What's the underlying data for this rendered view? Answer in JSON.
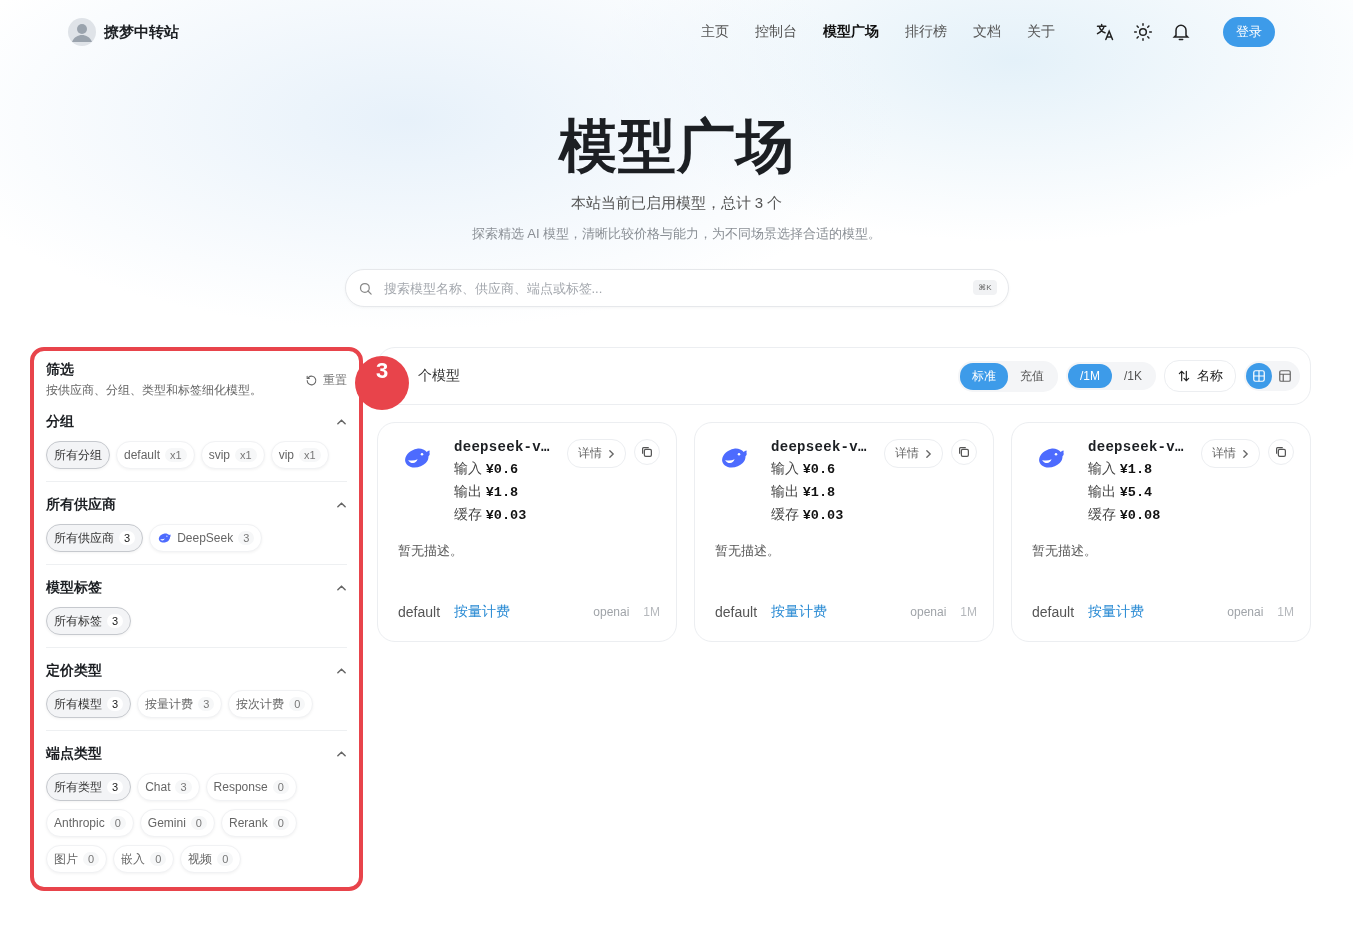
{
  "site": {
    "name": "撩梦中转站"
  },
  "nav": [
    {
      "label": "主页",
      "selected": false
    },
    {
      "label": "控制台",
      "selected": false
    },
    {
      "label": "模型广场",
      "selected": true
    },
    {
      "label": "排行榜",
      "selected": false
    },
    {
      "label": "文档",
      "selected": false
    },
    {
      "label": "关于",
      "selected": false
    }
  ],
  "login": "登录",
  "hero": {
    "title": "模型广场",
    "subtitle": "本站当前已启用模型，总计 3 个",
    "description": "探索精选 AI 模型，清晰比较价格与能力，为不同场景选择合适的模型。"
  },
  "search": {
    "placeholder": "搜索模型名称、供应商、端点或标签...",
    "shortcut": "⌘K"
  },
  "filters": {
    "title": "筛选",
    "description": "按供应商、分组、类型和标签细化模型。",
    "reset": "重置",
    "sections": [
      {
        "title": "分组",
        "expanded": true,
        "chips": [
          {
            "kind": "plain",
            "label": "所有分组",
            "selected": true
          },
          {
            "kind": "plain",
            "label": "default",
            "count": "x1",
            "selected": false
          },
          {
            "kind": "plain",
            "label": "svip",
            "count": "x1",
            "selected": false
          },
          {
            "kind": "plain",
            "label": "vip",
            "count": "x1",
            "selected": false
          }
        ]
      },
      {
        "title": "所有供应商",
        "expanded": true,
        "chips": [
          {
            "kind": "plain",
            "label": "所有供应商",
            "count": "3",
            "selected": true
          },
          {
            "kind": "brand",
            "label": "DeepSeek",
            "count": "3",
            "selected": false
          }
        ]
      },
      {
        "title": "模型标签",
        "expanded": true,
        "chips": [
          {
            "kind": "plain",
            "label": "所有标签",
            "count": "3",
            "selected": true
          }
        ]
      },
      {
        "title": "定价类型",
        "expanded": true,
        "chips": [
          {
            "kind": "plain",
            "label": "所有模型",
            "count": "3",
            "selected": true
          },
          {
            "kind": "plain",
            "label": "按量计费",
            "count": "3",
            "selected": false
          },
          {
            "kind": "plain",
            "label": "按次计费",
            "count": "0",
            "selected": false
          }
        ]
      },
      {
        "title": "端点类型",
        "expanded": true,
        "chips": [
          {
            "kind": "plain",
            "label": "所有类型",
            "count": "3",
            "selected": true
          },
          {
            "kind": "plain",
            "label": "Chat",
            "count": "3",
            "selected": false
          },
          {
            "kind": "plain",
            "label": "Response",
            "count": "0",
            "selected": false
          },
          {
            "kind": "plain",
            "label": "Anthropic",
            "count": "0",
            "selected": false
          },
          {
            "kind": "plain",
            "label": "Gemini",
            "count": "0",
            "selected": false
          },
          {
            "kind": "plain",
            "label": "Rerank",
            "count": "0",
            "selected": false
          },
          {
            "kind": "plain",
            "label": "图片",
            "count": "0",
            "selected": false
          },
          {
            "kind": "plain",
            "label": "嵌入",
            "count": "0",
            "selected": false
          },
          {
            "kind": "plain",
            "label": "视频",
            "count": "0",
            "selected": false
          }
        ]
      }
    ]
  },
  "annotation": {
    "label": "3"
  },
  "toolbar": {
    "count_label": "个模型",
    "price_modes": [
      {
        "label": "标准",
        "selected": true
      },
      {
        "label": "充值",
        "selected": false
      }
    ],
    "units": [
      {
        "label": "/1M",
        "selected": true
      },
      {
        "label": "/1K",
        "selected": false
      }
    ],
    "sort": "名称",
    "views": [
      {
        "kind": "grid",
        "selected": true
      },
      {
        "kind": "table",
        "selected": false
      }
    ]
  },
  "cards": [
    {
      "name": "deepseek-v…",
      "details": "详情",
      "prices": [
        {
          "label": "输入",
          "value": "¥0.6"
        },
        {
          "label": "输出",
          "value": "¥1.8"
        },
        {
          "label": "缓存",
          "value": "¥0.03"
        }
      ],
      "description": "暂无描述。",
      "group": "default",
      "billing": "按量计费",
      "endpoint": "openai",
      "unit": "1M"
    },
    {
      "name": "deepseek-v…",
      "details": "详情",
      "prices": [
        {
          "label": "输入",
          "value": "¥0.6"
        },
        {
          "label": "输出",
          "value": "¥1.8"
        },
        {
          "label": "缓存",
          "value": "¥0.03"
        }
      ],
      "description": "暂无描述。",
      "group": "default",
      "billing": "按量计费",
      "endpoint": "openai",
      "unit": "1M"
    },
    {
      "name": "deepseek-v…",
      "details": "详情",
      "prices": [
        {
          "label": "输入",
          "value": "¥1.8"
        },
        {
          "label": "输出",
          "value": "¥5.4"
        },
        {
          "label": "缓存",
          "value": "¥0.08"
        }
      ],
      "description": "暂无描述。",
      "group": "default",
      "billing": "按量计费",
      "endpoint": "openai",
      "unit": "1M"
    }
  ]
}
